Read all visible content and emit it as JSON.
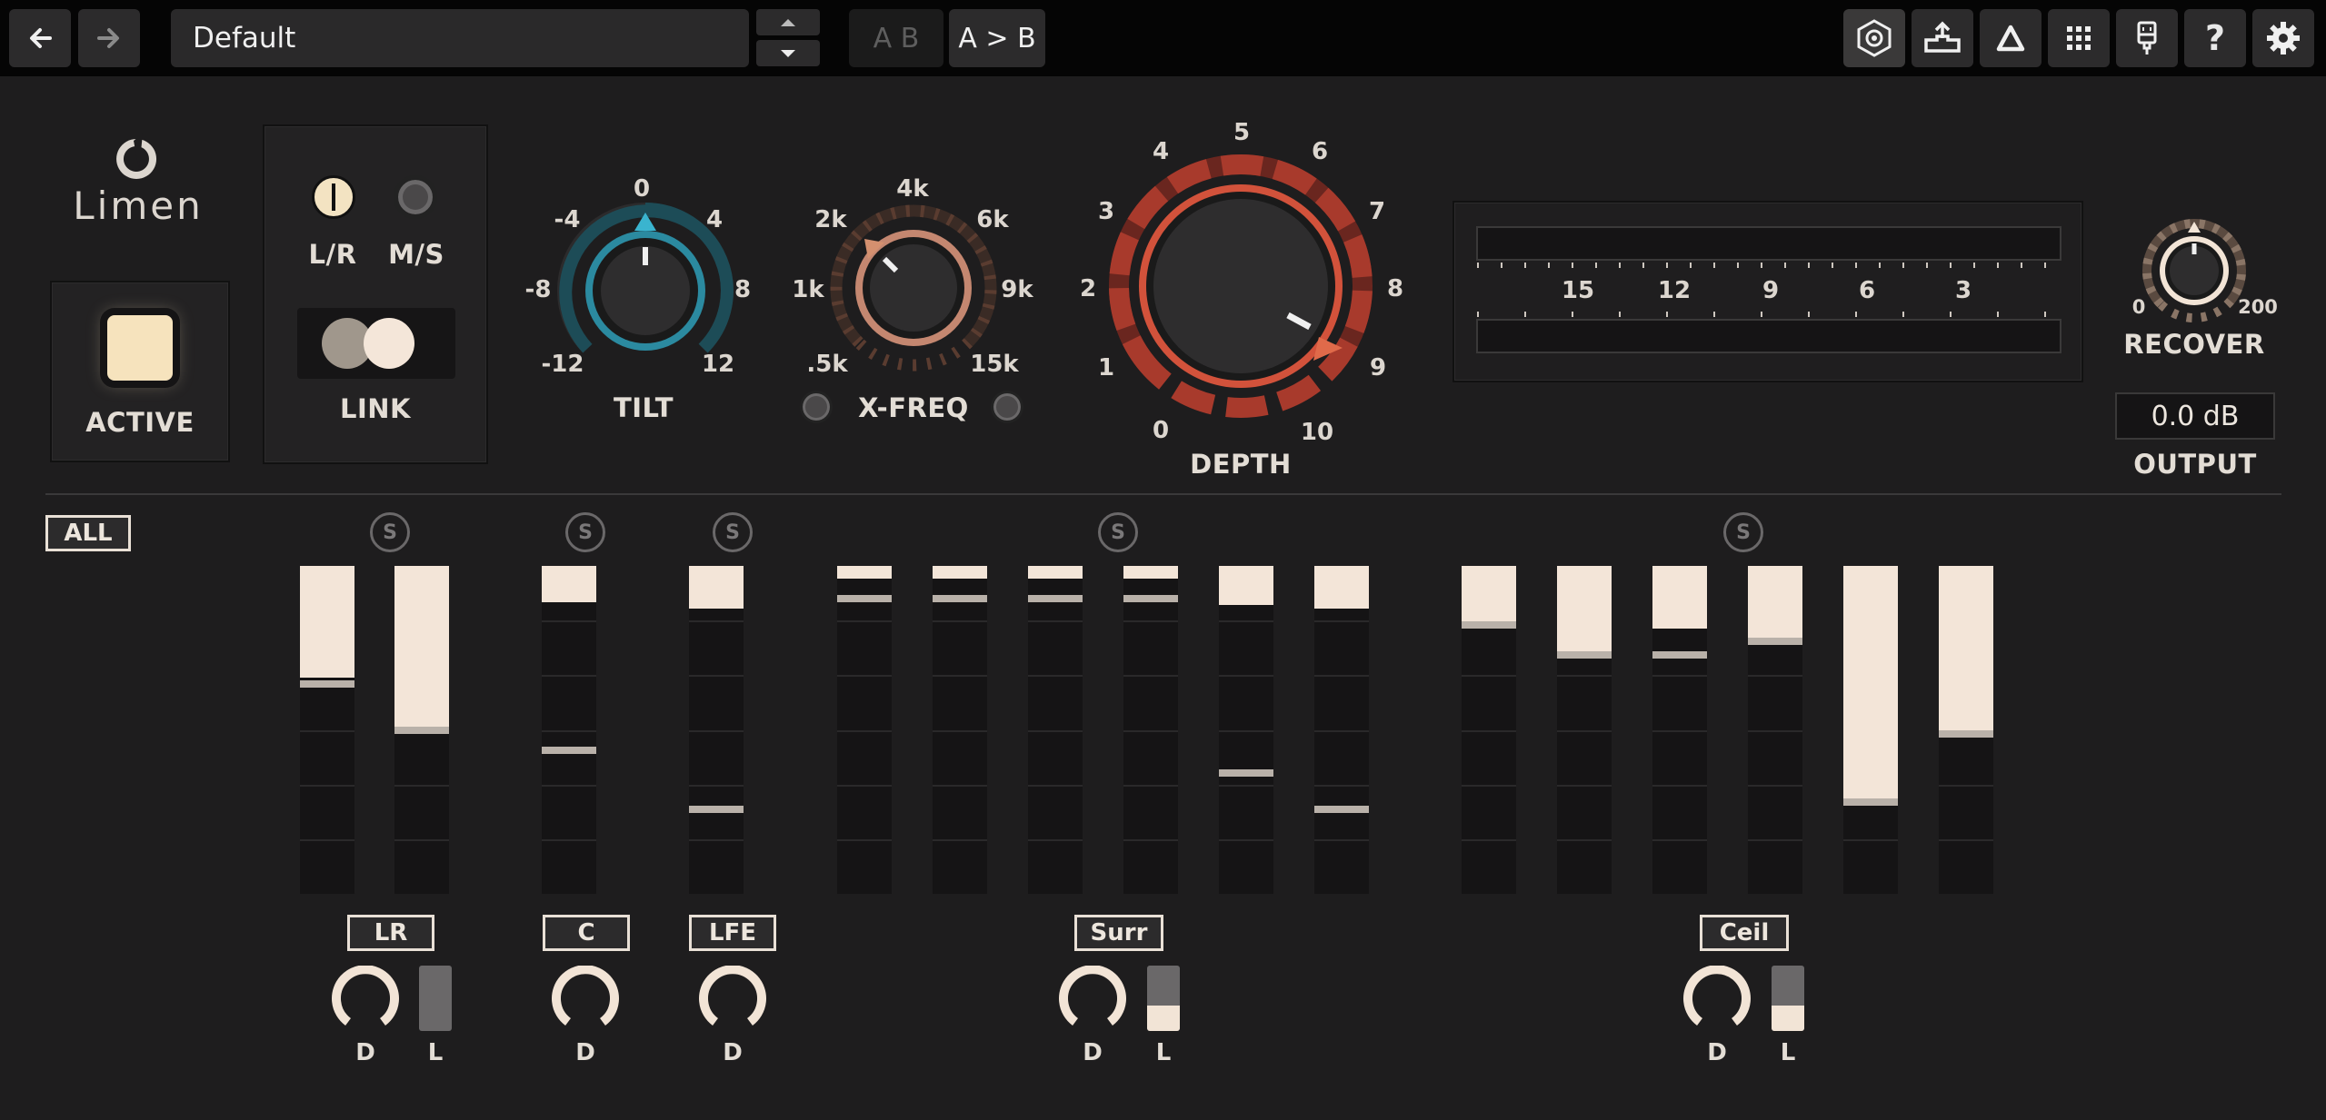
{
  "toolbar": {
    "back_icon": "arrow-left-icon",
    "forward_icon": "arrow-right-icon",
    "preset_name": "Default",
    "ab_label": "A B",
    "copy_label": "A > B",
    "icons": [
      "target-icon",
      "export-icon",
      "delta-icon",
      "grid-icon",
      "plug-icon",
      "help-icon",
      "gear-icon"
    ],
    "help_label": "?"
  },
  "brand": {
    "name": "Limen"
  },
  "active": {
    "label": "ACTIVE"
  },
  "mode": {
    "lr_label": "L/R",
    "ms_label": "M/S",
    "link_label": "LINK"
  },
  "tilt": {
    "label": "TILT",
    "scale": [
      "-12",
      "-8",
      "-4",
      "0",
      "4",
      "8",
      "12"
    ],
    "value": 0
  },
  "xfreq": {
    "label": "X-FREQ",
    "scale": [
      ".5k",
      "1k",
      "2k",
      "4k",
      "6k",
      "9k",
      "15k"
    ],
    "value_note": "2k"
  },
  "depth": {
    "label": "DEPTH",
    "scale": [
      "0",
      "1",
      "2",
      "3",
      "4",
      "5",
      "6",
      "7",
      "8",
      "9",
      "10"
    ],
    "value": 8.8
  },
  "meter_scale": {
    "labels": [
      "15",
      "12",
      "9",
      "6",
      "3"
    ]
  },
  "recover": {
    "label": "RECOVER",
    "min": "0",
    "max": "200"
  },
  "output": {
    "value": "0.0 dB",
    "label": "OUTPUT"
  },
  "channels": {
    "all_label": "ALL",
    "solo_label": "S",
    "groups": [
      {
        "tag": "LR",
        "d_label": "D",
        "l_label": "L",
        "fills": [
          0.34,
          0.49
        ],
        "lines": [
          0.35,
          0.49
        ]
      },
      {
        "tag": "C",
        "d_label": "D",
        "fills": [
          0.11
        ],
        "lines": [
          0.55
        ]
      },
      {
        "tag": "LFE",
        "d_label": "D",
        "fills": [
          0.13
        ],
        "lines": [
          0.73
        ]
      },
      {
        "tag": "Surr",
        "d_label": "D",
        "l_label": "L",
        "fills": [
          0.04,
          0.04,
          0.04,
          0.04,
          0.12,
          0.13
        ],
        "lines": [
          0.09,
          0.09,
          0.09,
          0.09,
          0.62,
          0.73
        ]
      },
      {
        "tag": "Ceil",
        "d_label": "D",
        "l_label": "L",
        "fills": [
          0.17,
          0.26,
          0.19,
          0.22,
          0.71,
          0.5
        ],
        "lines": [
          0.17,
          0.26,
          0.26,
          0.22,
          0.71,
          0.5
        ]
      }
    ]
  }
}
